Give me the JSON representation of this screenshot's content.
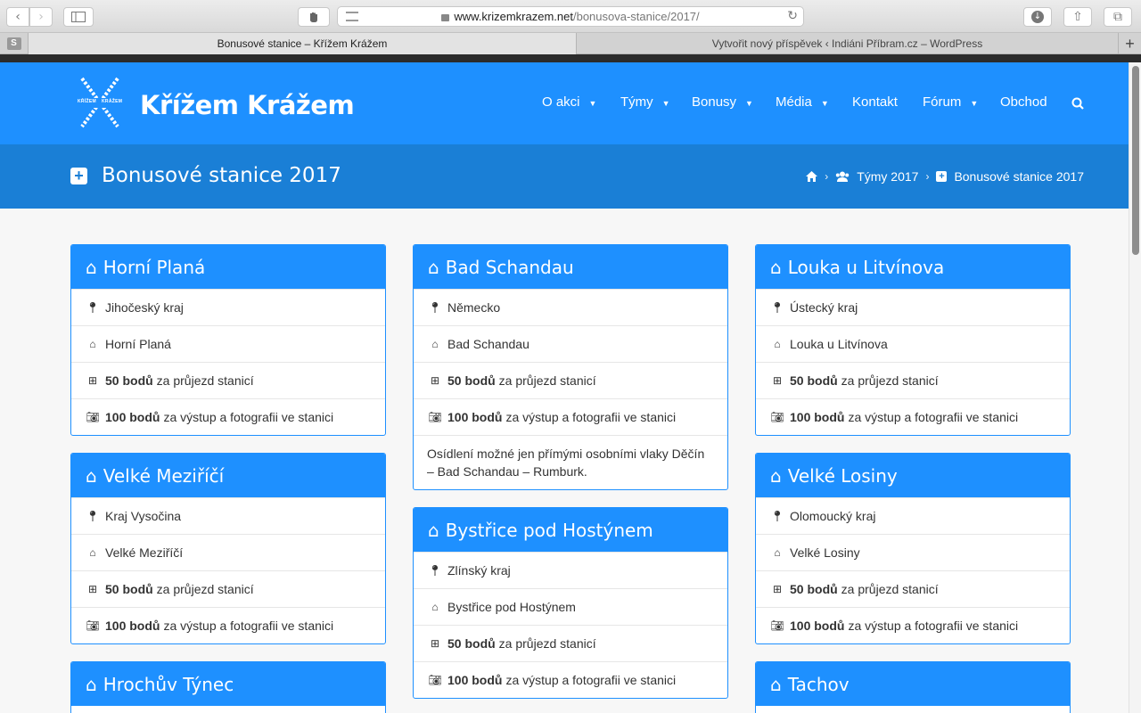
{
  "browser": {
    "url_domain": "www.krizemkrazem.net",
    "url_path": "/bonusova-stanice/2017/",
    "tabs": [
      {
        "label": "Bonusové stanice – Křížem Krážem",
        "active": true
      },
      {
        "label": "Vytvořit nový příspěvek ‹ Indiáni Příbram.cz – WordPress",
        "active": false
      }
    ],
    "extension_letter": "S"
  },
  "site": {
    "brand": "Křížem Krážem",
    "logo_text_top": "KŘÍŽEM",
    "logo_text_bottom": "KRÁŽEM",
    "nav": [
      {
        "label": "O akci",
        "dropdown": true
      },
      {
        "label": "Týmy",
        "dropdown": true
      },
      {
        "label": "Bonusy",
        "dropdown": true
      },
      {
        "label": "Média",
        "dropdown": true
      },
      {
        "label": "Kontakt",
        "dropdown": false
      },
      {
        "label": "Fórum",
        "dropdown": true
      },
      {
        "label": "Obchod",
        "dropdown": false
      }
    ],
    "page_title": "Bonusové stanice 2017",
    "breadcrumb": [
      "Týmy 2017",
      "Bonusové stanice 2017"
    ],
    "colors": {
      "primary": "#1e90ff",
      "title_bar": "#1a7fd6"
    }
  },
  "stations": [
    {
      "name": "Horní Planá",
      "region": "Jihočeský kraj",
      "town": "Horní Planá",
      "points_pass": "50 bodů",
      "pass_text": "za průjezd stanicí",
      "points_photo": "100 bodů",
      "photo_text": "za výstup a fotografii ve stanici"
    },
    {
      "name": "Bad Schandau",
      "region": "Německo",
      "town": "Bad Schandau",
      "points_pass": "50 bodů",
      "pass_text": "za průjezd stanicí",
      "points_photo": "100 bodů",
      "photo_text": "za výstup a fotografii ve stanici",
      "note": "Osídlení možné jen přímými osobními vlaky Děčín – Bad Schandau – Rumburk."
    },
    {
      "name": "Louka u Litvínova",
      "region": "Ústecký kraj",
      "town": "Louka u Litvínova",
      "points_pass": "50 bodů",
      "pass_text": "za průjezd stanicí",
      "points_photo": "100 bodů",
      "photo_text": "za výstup a fotografii ve stanici"
    },
    {
      "name": "Velké Meziříčí",
      "region": "Kraj Vysočina",
      "town": "Velké Meziříčí",
      "points_pass": "50 bodů",
      "pass_text": "za průjezd stanicí",
      "points_photo": "100 bodů",
      "photo_text": "za výstup a fotografii ve stanici"
    },
    {
      "name": "Bystřice pod Hostýnem",
      "region": "Zlínský kraj",
      "town": "Bystřice pod Hostýnem",
      "points_pass": "50 bodů",
      "pass_text": "za průjezd stanicí",
      "points_photo": "100 bodů",
      "photo_text": "za výstup a fotografii ve stanici"
    },
    {
      "name": "Velké Losiny",
      "region": "Olomoucký kraj",
      "town": "Velké Losiny",
      "points_pass": "50 bodů",
      "pass_text": "za průjezd stanicí",
      "points_photo": "100 bodů",
      "photo_text": "za výstup a fotografii ve stanici"
    },
    {
      "name": "Hrochův Týnec"
    },
    {
      "name": "Tachov"
    }
  ]
}
